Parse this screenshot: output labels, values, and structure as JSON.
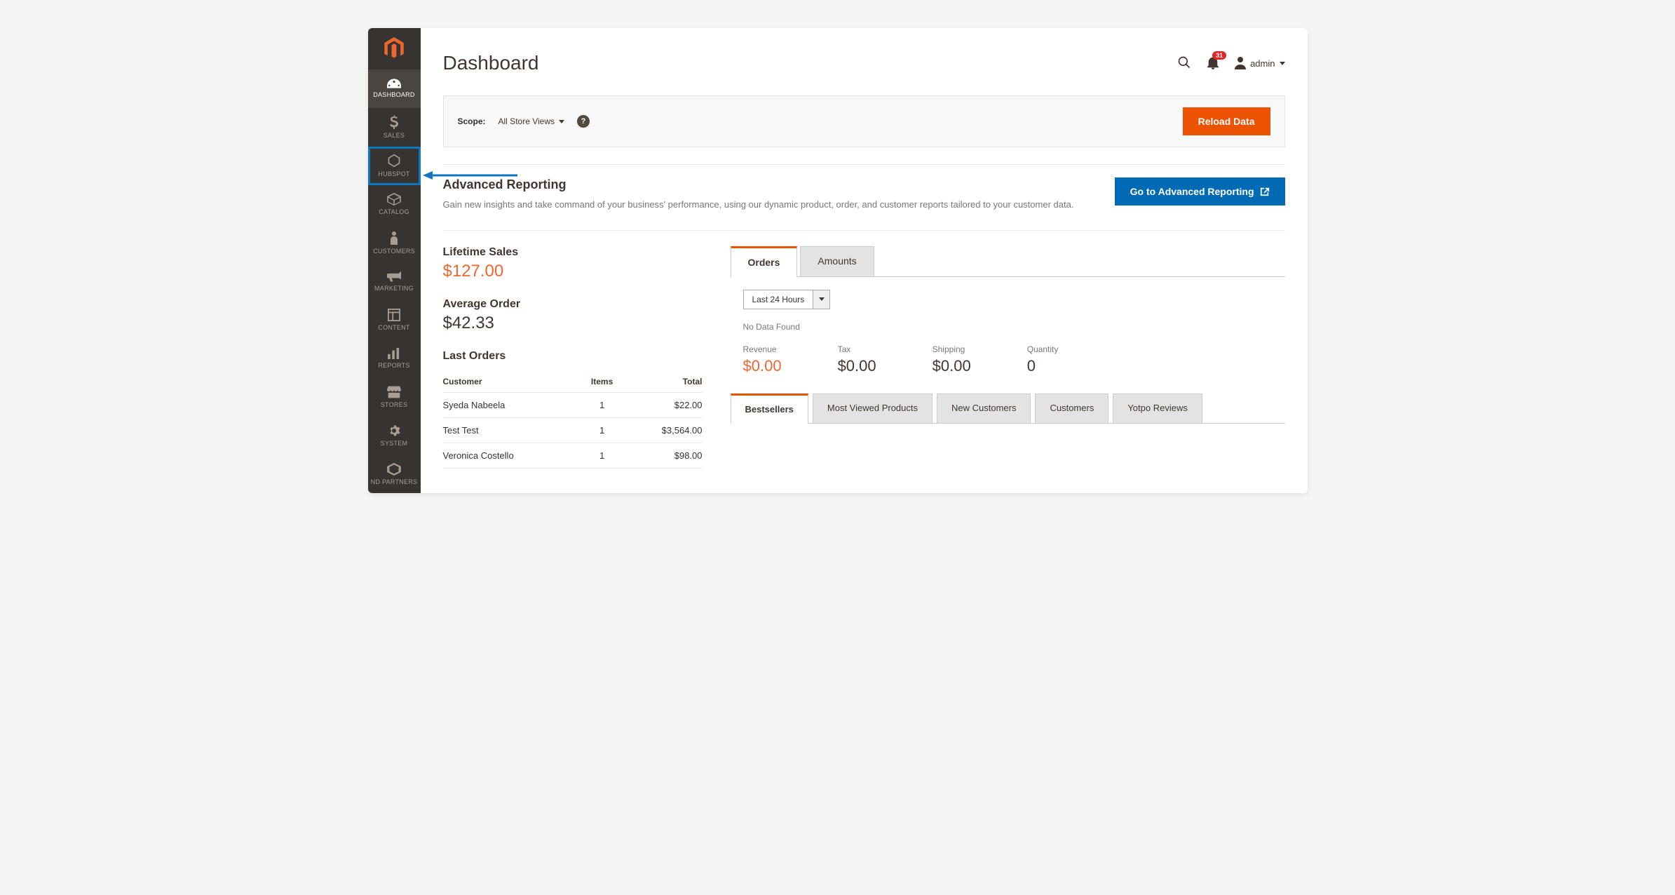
{
  "sidebar": {
    "items": [
      {
        "label": "DASHBOARD"
      },
      {
        "label": "SALES"
      },
      {
        "label": "HUBSPOT"
      },
      {
        "label": "CATALOG"
      },
      {
        "label": "CUSTOMERS"
      },
      {
        "label": "MARKETING"
      },
      {
        "label": "CONTENT"
      },
      {
        "label": "REPORTS"
      },
      {
        "label": "STORES"
      },
      {
        "label": "SYSTEM"
      },
      {
        "label": "ND PARTNERS"
      }
    ]
  },
  "header": {
    "title": "Dashboard",
    "notif_count": "31",
    "username": "admin"
  },
  "scope": {
    "label": "Scope:",
    "value": "All Store Views",
    "reload_button": "Reload Data"
  },
  "advanced_reporting": {
    "title": "Advanced Reporting",
    "description": "Gain new insights and take command of your business' performance, using our dynamic product, order, and customer reports tailored to your customer data.",
    "button": "Go to Advanced Reporting"
  },
  "lifetime_sales": {
    "title": "Lifetime Sales",
    "value": "$127.00"
  },
  "average_order": {
    "title": "Average Order",
    "value": "$42.33"
  },
  "last_orders": {
    "title": "Last Orders",
    "headers": {
      "customer": "Customer",
      "items": "Items",
      "total": "Total"
    },
    "rows": [
      {
        "customer": "Syeda Nabeela",
        "items": "1",
        "total": "$22.00"
      },
      {
        "customer": "Test Test",
        "items": "1",
        "total": "$3,564.00"
      },
      {
        "customer": "Veronica Costello",
        "items": "1",
        "total": "$98.00"
      }
    ]
  },
  "chart_tabs": {
    "orders": "Orders",
    "amounts": "Amounts"
  },
  "range_select": "Last 24 Hours",
  "no_data": "No Data Found",
  "totals": {
    "revenue": {
      "label": "Revenue",
      "value": "$0.00"
    },
    "tax": {
      "label": "Tax",
      "value": "$0.00"
    },
    "shipping": {
      "label": "Shipping",
      "value": "$0.00"
    },
    "quantity": {
      "label": "Quantity",
      "value": "0"
    }
  },
  "report_tabs": {
    "bestsellers": "Bestsellers",
    "most_viewed": "Most Viewed Products",
    "new_customers": "New Customers",
    "customers": "Customers",
    "yotpo": "Yotpo Reviews"
  }
}
